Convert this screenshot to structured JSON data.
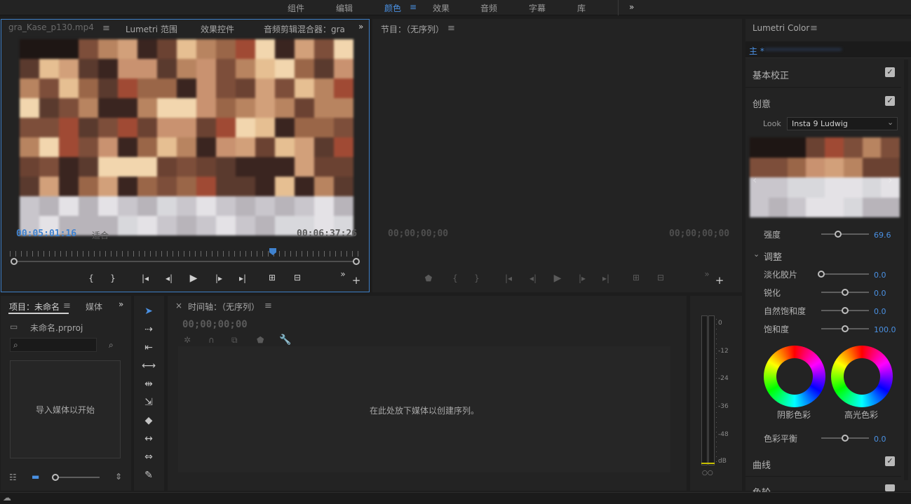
{
  "workspace_tabs": [
    "组件",
    "编辑",
    "颜色",
    "效果",
    "音频",
    "字幕",
    "库"
  ],
  "workspace_active": "颜色",
  "workspace_menu_icon": "≡",
  "workspace_more_icon": "»",
  "source_panel": {
    "tabs": [
      "Lumetri 范围",
      "效果控件",
      "音频剪辑混合器：gra"
    ],
    "active_tab_label": "gra_Kase_p130.mp4",
    "timecode_in": "00:05:01:16",
    "fit_label": "适合",
    "timecode_duration": "00:06:37:26"
  },
  "program_panel": {
    "title": "节目：（无序列）",
    "timecode_left": "00;00;00;00",
    "timecode_right": "00;00;00;00"
  },
  "project_panel": {
    "tabs": [
      "项目：未命名",
      "媒体"
    ],
    "file_name": "未命名.prproj",
    "import_hint": "导入媒体以开始"
  },
  "timeline_panel": {
    "close_icon": "×",
    "title": "时间轴：（无序列）",
    "timecode": "00;00;00;00",
    "drop_hint": "在此处放下媒体以创建序列。"
  },
  "audio_meter": {
    "ticks": [
      "0",
      "-12",
      "-24",
      "-36",
      "-48",
      "dB"
    ]
  },
  "lumetri": {
    "title": "Lumetri Color",
    "master_label": "主 *",
    "sections": {
      "basic": "基本校正",
      "creative": "创意",
      "curves": "曲线",
      "cut": "色轮"
    },
    "look_label": "Look",
    "look_value": "Insta 9 Ludwig",
    "intensity_label": "强度",
    "intensity_value": "69.6",
    "adjust_label": "调整",
    "faded_film_label": "淡化胶片",
    "faded_film_value": "0.0",
    "sharpen_label": "锐化",
    "sharpen_value": "0.0",
    "vibrance_label": "自然饱和度",
    "vibrance_value": "0.0",
    "saturation_label": "饱和度",
    "saturation_value": "100.0",
    "shadow_tint_label": "阴影色彩",
    "highlight_tint_label": "高光色彩",
    "tint_balance_label": "色彩平衡",
    "tint_balance_value": "0.0",
    "intensity_fraction": 0.35,
    "faded_fraction": 0.0,
    "sharpen_fraction": 0.5,
    "vibrance_fraction": 0.5,
    "saturation_fraction": 0.5,
    "balance_fraction": 0.5
  },
  "colors": {
    "accent": "#4a90e2",
    "panel_bg": "#232323",
    "app_bg": "#1d1d1d"
  }
}
